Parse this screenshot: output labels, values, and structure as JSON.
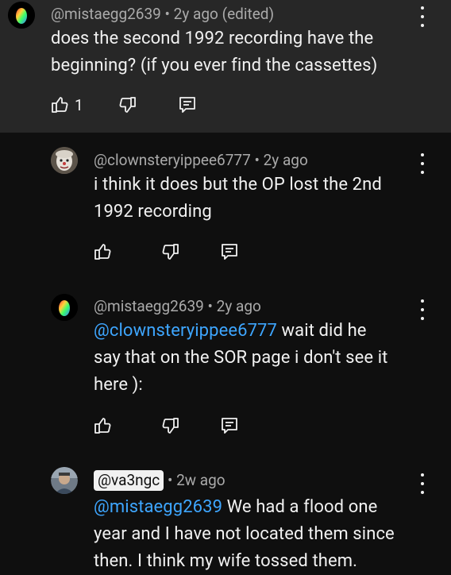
{
  "comments": [
    {
      "author": "@mistaegg2639",
      "time": "2y ago (edited)",
      "text_lines": [
        "does the second 1992 recording have the",
        "beginning? (if you ever find the cassettes)"
      ],
      "likes": "1"
    },
    {
      "author": "@clownsteryippee6777",
      "time": "2y ago",
      "text_lines": [
        "i think it does but the OP lost the 2nd",
        "1992 recording"
      ]
    },
    {
      "author": "@mistaegg2639",
      "time": "2y ago",
      "mention": "@clownsteryippee6777",
      "text_lines": [
        " wait did he",
        "say that on the SOR page i don't see it",
        "here ):"
      ]
    },
    {
      "author": "@va3ngc",
      "time": "2w ago",
      "mention": "@mistaegg2639",
      "text_lines": [
        " We had a flood one",
        "year and I have not located them since",
        "then.  I think my wife tossed them."
      ]
    }
  ],
  "separator": " • ",
  "icons": [
    "thumbs-up-icon",
    "thumbs-down-icon",
    "reply-icon",
    "more-vert-icon"
  ],
  "colors": {
    "background": "#0f0f0f",
    "highlight": "#272727",
    "mention": "#3ea6ff",
    "meta": "#aaaaaa"
  }
}
